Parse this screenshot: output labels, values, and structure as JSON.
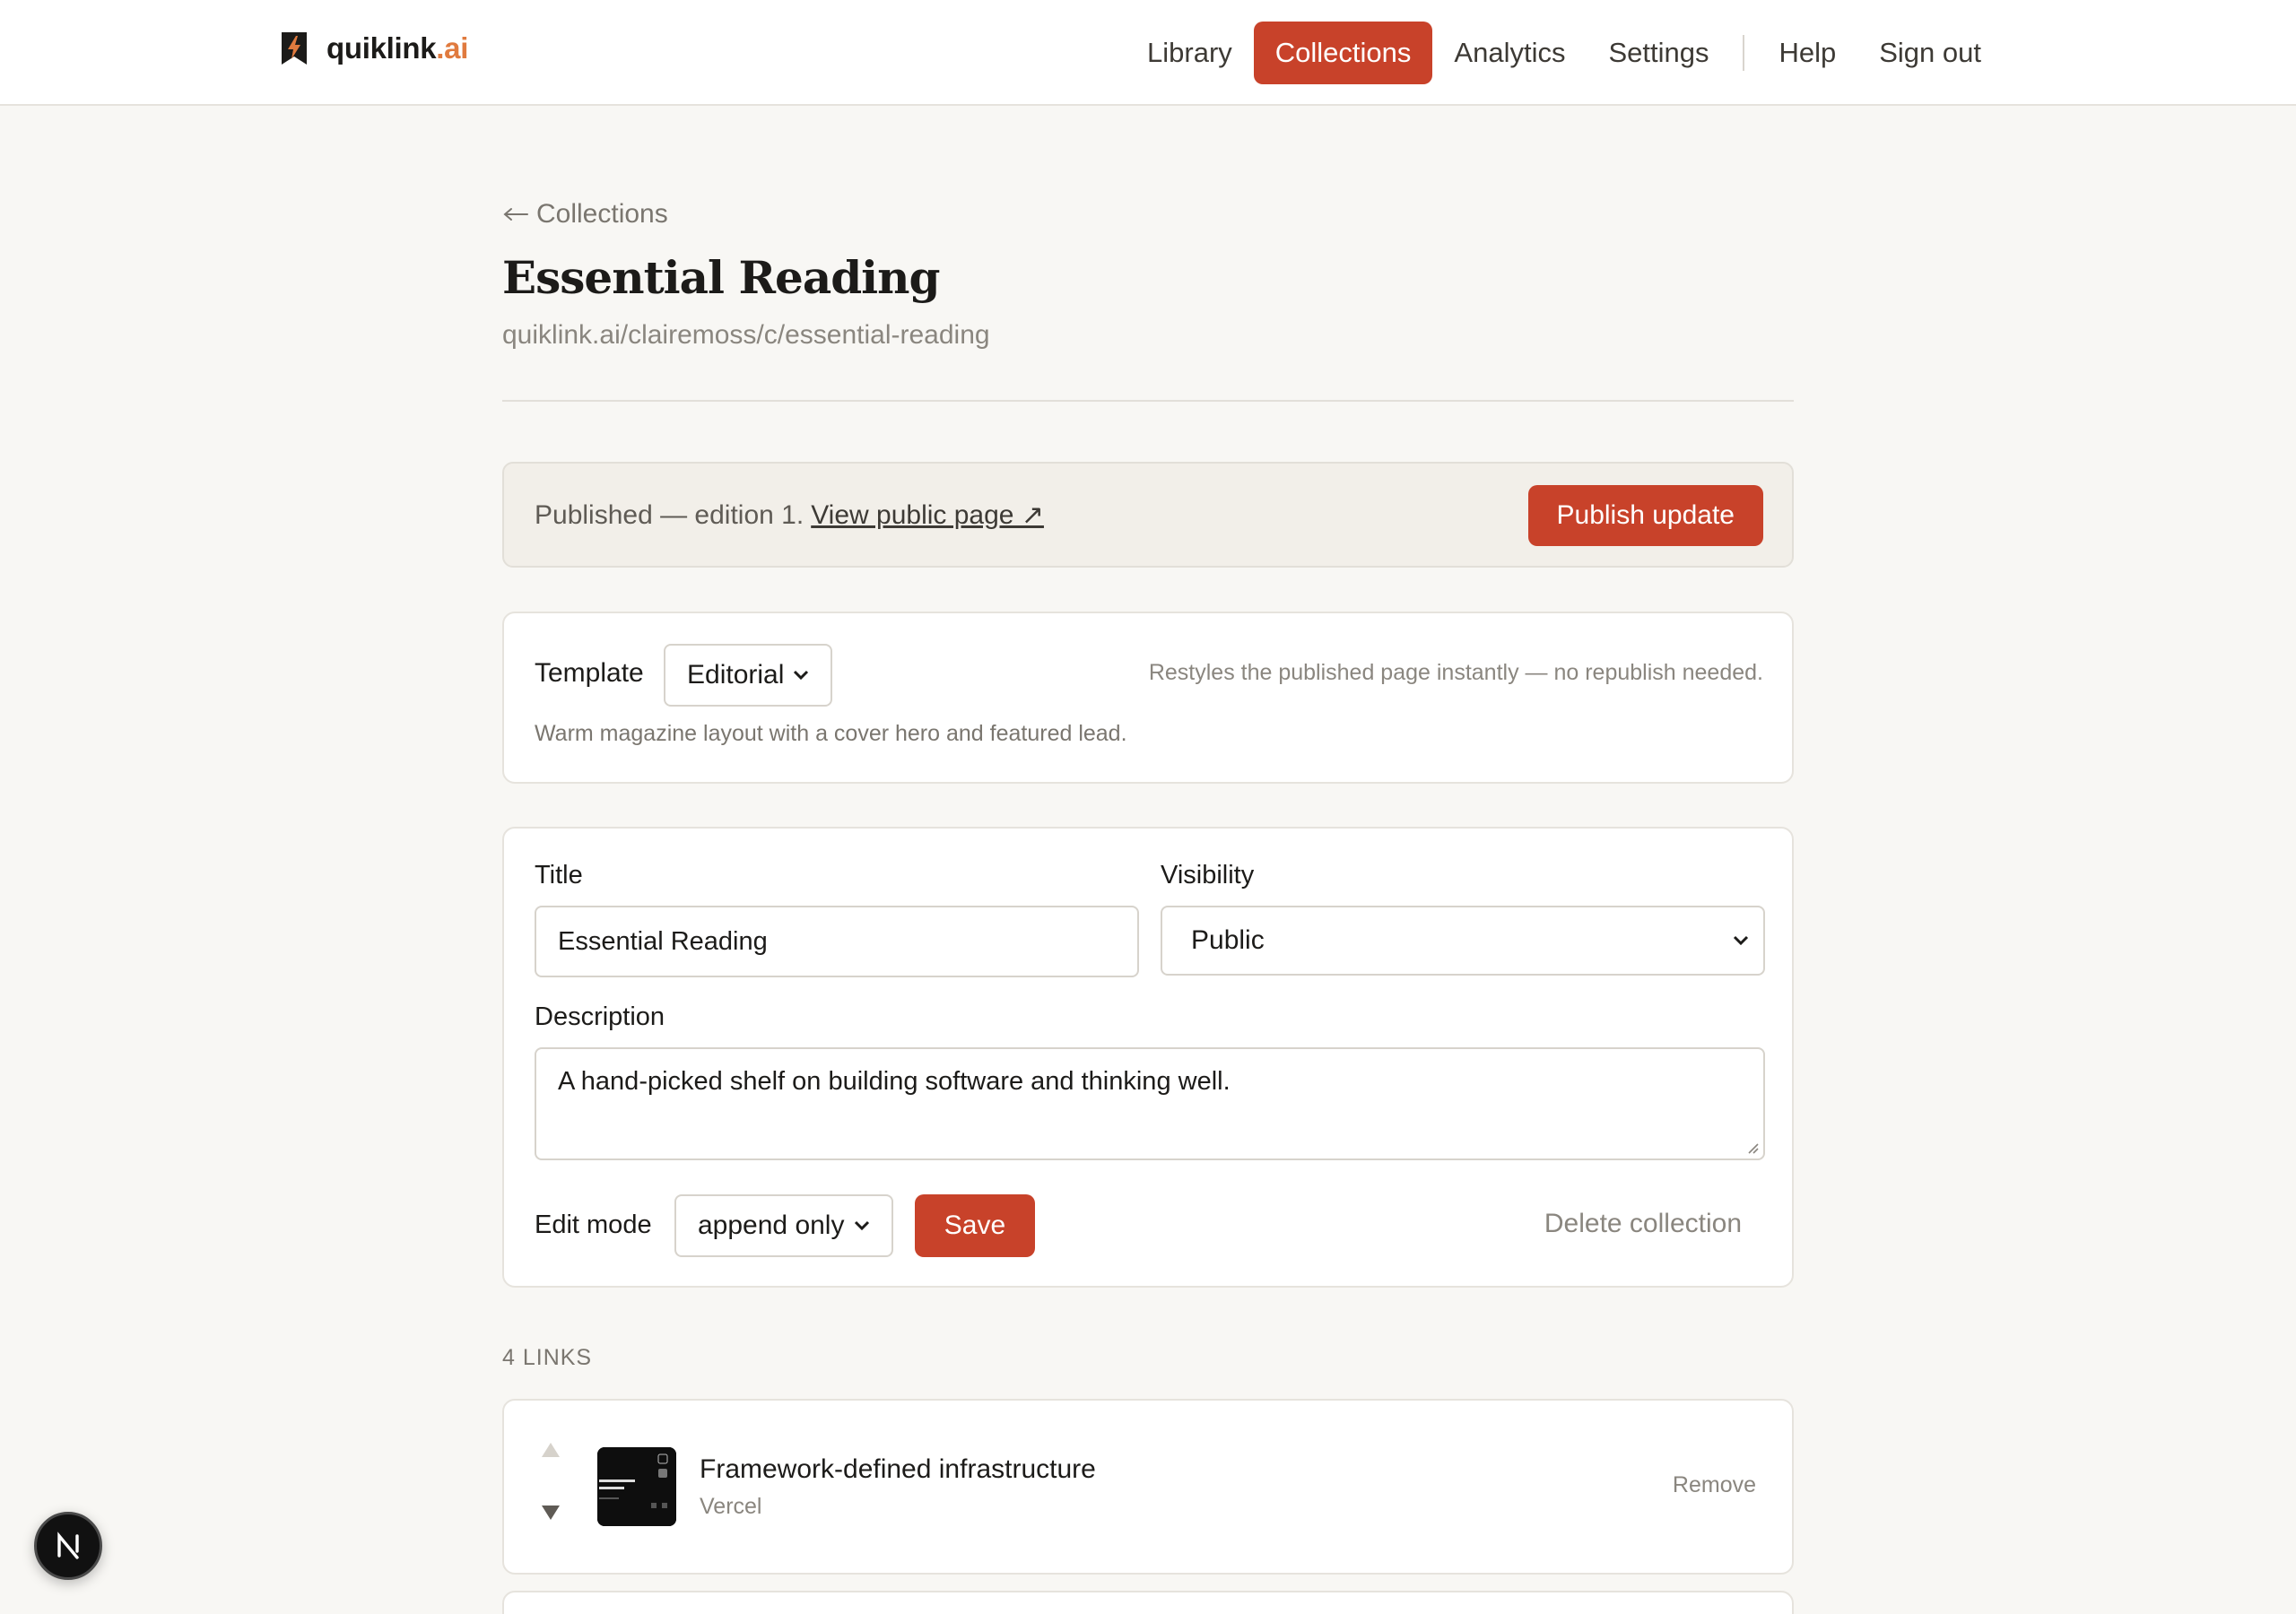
{
  "brand": {
    "name": "quiklink",
    "suffix": ".ai"
  },
  "nav": {
    "items": [
      {
        "label": "Library",
        "active": false
      },
      {
        "label": "Collections",
        "active": true
      },
      {
        "label": "Analytics",
        "active": false
      },
      {
        "label": "Settings",
        "active": false
      },
      {
        "label": "Help",
        "active": false
      },
      {
        "label": "Sign out",
        "active": false
      }
    ]
  },
  "page": {
    "back_link": "Collections",
    "title": "Essential Reading",
    "url": "quiklink.ai/clairemoss/c/essential-reading"
  },
  "banner": {
    "status_text": "Published — edition 1.",
    "public_link": "View public page ↗",
    "publish_button": "Publish update"
  },
  "template": {
    "label": "Template",
    "selected": "Editorial",
    "note": "Restyles the published page instantly — no republish needed.",
    "description": "Warm magazine layout with a cover hero and featured lead."
  },
  "form": {
    "title_label": "Title",
    "title_value": "Essential Reading",
    "visibility_label": "Visibility",
    "visibility_value": "Public",
    "description_label": "Description",
    "description_value": "A hand-picked shelf on building software and thinking well.",
    "edit_mode_label": "Edit mode",
    "edit_mode_value": "append only",
    "save_button": "Save",
    "delete_link": "Delete collection"
  },
  "links": {
    "count_label": "4 LINKS",
    "items": [
      {
        "title": "Framework-defined infrastructure",
        "source": "Vercel",
        "remove": "Remove"
      }
    ]
  },
  "colors": {
    "accent": "#c8422a",
    "brand_suffix": "#e07a3e",
    "background": "#f8f7f4"
  },
  "icons": {
    "logo": "bookmark-bolt-icon",
    "back": "arrow-left-icon",
    "select": "chevron-down-icon",
    "move_up": "triangle-up-icon",
    "move_down": "triangle-down-icon",
    "dev_badge": "nextjs-icon"
  }
}
